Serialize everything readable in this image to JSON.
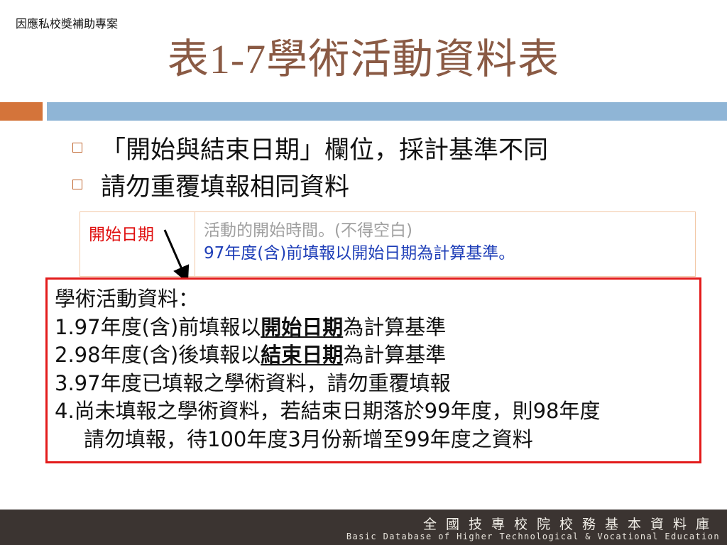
{
  "header": {
    "tag": "因應私校獎補助專案"
  },
  "title": "表1-7學術活動資料表",
  "bullets": [
    "「開始與結束日期」欄位，採計基準不同",
    "請勿重覆填報相同資料"
  ],
  "field_table": {
    "name": "開始日期",
    "desc_line1": "活動的開始時間。(不得空白)",
    "desc_line2": "97年度(含)前填報以開始日期為計算基準。"
  },
  "note": {
    "heading": "學術活動資料：",
    "item1_prefix": "1.97年度(含)前填報以",
    "item1_emph": "開始日期",
    "item1_suffix": "為計算基準",
    "item2_prefix": "2.98年度(含)後填報以",
    "item2_emph": "結束日期",
    "item2_suffix": "為計算基準",
    "item3": "3.97年度已填報之學術資料，請勿重覆填報",
    "item4_line1": "4.尚未填報之學術資料，若結束日期落於99年度，則98年度",
    "item4_line2": "請勿填報，待100年度3月份新增至99年度之資料"
  },
  "footer": {
    "line1": "全國技專校院校務基本資料庫",
    "line2": "Basic Database of Higher Technological & Vocational Education"
  },
  "colors": {
    "title": "#8a5a44",
    "accent_orange": "#d4743a",
    "accent_blue": "#8fb5d6",
    "note_border": "#e31b1b",
    "field_name": "#e01010",
    "desc_blue": "#1f3fb8",
    "footer_bg": "#3b3431"
  },
  "icons": {
    "bullet": "hollow-square-icon",
    "arrow": "arrow-down-icon"
  }
}
